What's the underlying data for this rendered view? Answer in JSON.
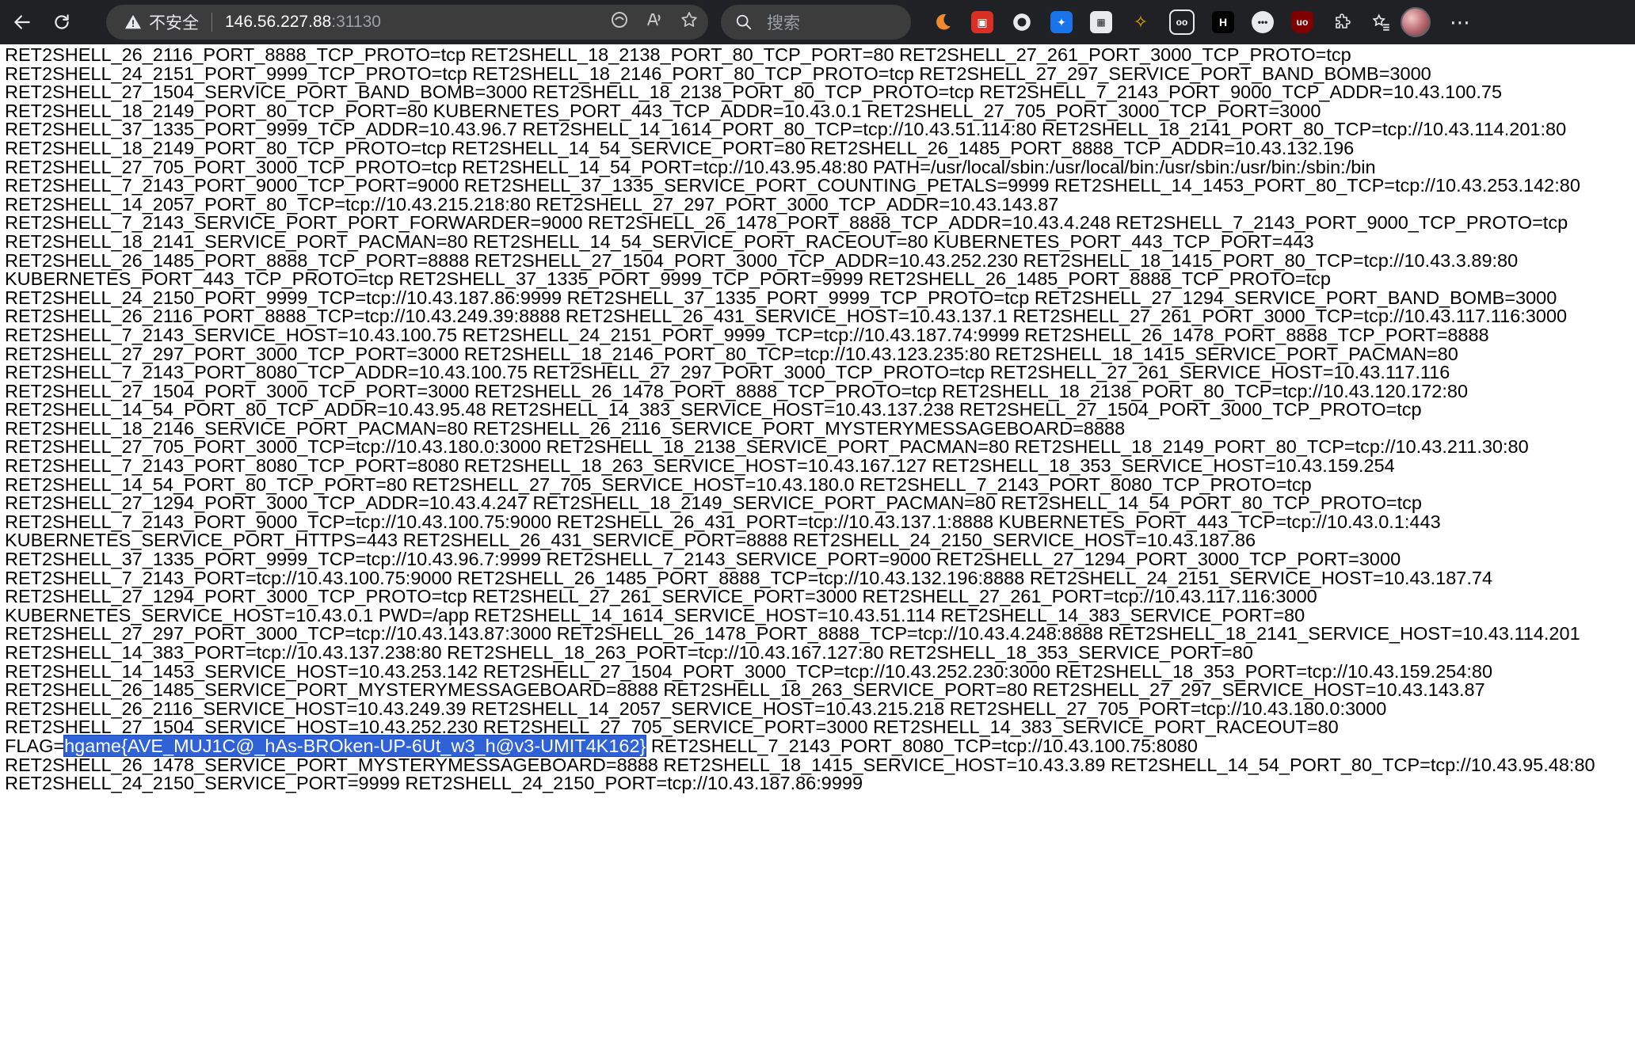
{
  "browser": {
    "security_label": "不安全",
    "url_host": "146.56.227.88",
    "url_port": ":31130",
    "search_placeholder": "搜索"
  },
  "content": {
    "lines": [
      "RET2SHELL_26_2116_PORT_8888_TCP_PROTO=tcp RET2SHELL_18_2138_PORT_80_TCP_PORT=80 RET2SHELL_27_261_PORT_3000_TCP_PROTO=tcp",
      "RET2SHELL_24_2151_PORT_9999_TCP_PROTO=tcp RET2SHELL_18_2146_PORT_80_TCP_PROTO=tcp RET2SHELL_27_297_SERVICE_PORT_BAND_BOMB=3000",
      "RET2SHELL_27_1504_SERVICE_PORT_BAND_BOMB=3000 RET2SHELL_18_2138_PORT_80_TCP_PROTO=tcp RET2SHELL_7_2143_PORT_9000_TCP_ADDR=10.43.100.75",
      "RET2SHELL_18_2149_PORT_80_TCP_PORT=80 KUBERNETES_PORT_443_TCP_ADDR=10.43.0.1 RET2SHELL_27_705_PORT_3000_TCP_PORT=3000",
      "RET2SHELL_37_1335_PORT_9999_TCP_ADDR=10.43.96.7 RET2SHELL_14_1614_PORT_80_TCP=tcp://10.43.51.114:80 RET2SHELL_18_2141_PORT_80_TCP=tcp://10.43.114.201:80",
      "RET2SHELL_18_2149_PORT_80_TCP_PROTO=tcp RET2SHELL_14_54_SERVICE_PORT=80 RET2SHELL_26_1485_PORT_8888_TCP_ADDR=10.43.132.196",
      "RET2SHELL_27_705_PORT_3000_TCP_PROTO=tcp RET2SHELL_14_54_PORT=tcp://10.43.95.48:80 PATH=/usr/local/sbin:/usr/local/bin:/usr/sbin:/usr/bin:/sbin:/bin",
      "RET2SHELL_7_2143_PORT_9000_TCP_PORT=9000 RET2SHELL_37_1335_SERVICE_PORT_COUNTING_PETALS=9999 RET2SHELL_14_1453_PORT_80_TCP=tcp://10.43.253.142:80",
      "RET2SHELL_14_2057_PORT_80_TCP=tcp://10.43.215.218:80 RET2SHELL_27_297_PORT_3000_TCP_ADDR=10.43.143.87",
      "RET2SHELL_7_2143_SERVICE_PORT_PORT_FORWARDER=9000 RET2SHELL_26_1478_PORT_8888_TCP_ADDR=10.43.4.248 RET2SHELL_7_2143_PORT_9000_TCP_PROTO=tcp",
      "RET2SHELL_18_2141_SERVICE_PORT_PACMAN=80 RET2SHELL_14_54_SERVICE_PORT_RACEOUT=80 KUBERNETES_PORT_443_TCP_PORT=443",
      "RET2SHELL_26_1485_PORT_8888_TCP_PORT=8888 RET2SHELL_27_1504_PORT_3000_TCP_ADDR=10.43.252.230 RET2SHELL_18_1415_PORT_80_TCP=tcp://10.43.3.89:80",
      "KUBERNETES_PORT_443_TCP_PROTO=tcp RET2SHELL_37_1335_PORT_9999_TCP_PORT=9999 RET2SHELL_26_1485_PORT_8888_TCP_PROTO=tcp",
      "RET2SHELL_24_2150_PORT_9999_TCP=tcp://10.43.187.86:9999 RET2SHELL_37_1335_PORT_9999_TCP_PROTO=tcp RET2SHELL_27_1294_SERVICE_PORT_BAND_BOMB=3000",
      "RET2SHELL_26_2116_PORT_8888_TCP=tcp://10.43.249.39:8888 RET2SHELL_26_431_SERVICE_HOST=10.43.137.1 RET2SHELL_27_261_PORT_3000_TCP=tcp://10.43.117.116:3000",
      "RET2SHELL_7_2143_SERVICE_HOST=10.43.100.75 RET2SHELL_24_2151_PORT_9999_TCP=tcp://10.43.187.74:9999 RET2SHELL_26_1478_PORT_8888_TCP_PORT=8888",
      "RET2SHELL_27_297_PORT_3000_TCP_PORT=3000 RET2SHELL_18_2146_PORT_80_TCP=tcp://10.43.123.235:80 RET2SHELL_18_1415_SERVICE_PORT_PACMAN=80",
      "RET2SHELL_7_2143_PORT_8080_TCP_ADDR=10.43.100.75 RET2SHELL_27_297_PORT_3000_TCP_PROTO=tcp RET2SHELL_27_261_SERVICE_HOST=10.43.117.116",
      "RET2SHELL_27_1504_PORT_3000_TCP_PORT=3000 RET2SHELL_26_1478_PORT_8888_TCP_PROTO=tcp RET2SHELL_18_2138_PORT_80_TCP=tcp://10.43.120.172:80",
      "RET2SHELL_14_54_PORT_80_TCP_ADDR=10.43.95.48 RET2SHELL_14_383_SERVICE_HOST=10.43.137.238 RET2SHELL_27_1504_PORT_3000_TCP_PROTO=tcp",
      "RET2SHELL_18_2146_SERVICE_PORT_PACMAN=80 RET2SHELL_26_2116_SERVICE_PORT_MYSTERYMESSAGEBOARD=8888",
      "RET2SHELL_27_705_PORT_3000_TCP=tcp://10.43.180.0:3000 RET2SHELL_18_2138_SERVICE_PORT_PACMAN=80 RET2SHELL_18_2149_PORT_80_TCP=tcp://10.43.211.30:80",
      "RET2SHELL_7_2143_PORT_8080_TCP_PORT=8080 RET2SHELL_18_263_SERVICE_HOST=10.43.167.127 RET2SHELL_18_353_SERVICE_HOST=10.43.159.254",
      "RET2SHELL_14_54_PORT_80_TCP_PORT=80 RET2SHELL_27_705_SERVICE_HOST=10.43.180.0 RET2SHELL_7_2143_PORT_8080_TCP_PROTO=tcp",
      "RET2SHELL_27_1294_PORT_3000_TCP_ADDR=10.43.4.247 RET2SHELL_18_2149_SERVICE_PORT_PACMAN=80 RET2SHELL_14_54_PORT_80_TCP_PROTO=tcp",
      "RET2SHELL_7_2143_PORT_9000_TCP=tcp://10.43.100.75:9000 RET2SHELL_26_431_PORT=tcp://10.43.137.1:8888 KUBERNETES_PORT_443_TCP=tcp://10.43.0.1:443",
      "KUBERNETES_SERVICE_PORT_HTTPS=443 RET2SHELL_26_431_SERVICE_PORT=8888 RET2SHELL_24_2150_SERVICE_HOST=10.43.187.86",
      "RET2SHELL_37_1335_PORT_9999_TCP=tcp://10.43.96.7:9999 RET2SHELL_7_2143_SERVICE_PORT=9000 RET2SHELL_27_1294_PORT_3000_TCP_PORT=3000",
      "RET2SHELL_7_2143_PORT=tcp://10.43.100.75:9000 RET2SHELL_26_1485_PORT_8888_TCP=tcp://10.43.132.196:8888 RET2SHELL_24_2151_SERVICE_HOST=10.43.187.74",
      "RET2SHELL_27_1294_PORT_3000_TCP_PROTO=tcp RET2SHELL_27_261_SERVICE_PORT=3000 RET2SHELL_27_261_PORT=tcp://10.43.117.116:3000",
      "KUBERNETES_SERVICE_HOST=10.43.0.1 PWD=/app RET2SHELL_14_1614_SERVICE_HOST=10.43.51.114 RET2SHELL_14_383_SERVICE_PORT=80",
      "RET2SHELL_27_297_PORT_3000_TCP=tcp://10.43.143.87:3000 RET2SHELL_26_1478_PORT_8888_TCP=tcp://10.43.4.248:8888 RET2SHELL_18_2141_SERVICE_HOST=10.43.114.201",
      "RET2SHELL_14_383_PORT=tcp://10.43.137.238:80 RET2SHELL_18_263_PORT=tcp://10.43.167.127:80 RET2SHELL_18_353_SERVICE_PORT=80",
      "RET2SHELL_14_1453_SERVICE_HOST=10.43.253.142 RET2SHELL_27_1504_PORT_3000_TCP=tcp://10.43.252.230:3000 RET2SHELL_18_353_PORT=tcp://10.43.159.254:80",
      "RET2SHELL_26_1485_SERVICE_PORT_MYSTERYMESSAGEBOARD=8888 RET2SHELL_18_263_SERVICE_PORT=80 RET2SHELL_27_297_SERVICE_HOST=10.43.143.87",
      "RET2SHELL_26_2116_SERVICE_HOST=10.43.249.39 RET2SHELL_14_2057_SERVICE_HOST=10.43.215.218 RET2SHELL_27_705_PORT=tcp://10.43.180.0:3000",
      "RET2SHELL_27_1504_SERVICE_HOST=10.43.252.230 RET2SHELL_27_705_SERVICE_PORT=3000 RET2SHELL_14_383_SERVICE_PORT_RACEOUT=80"
    ],
    "flag_line": {
      "prefix": "FLAG=",
      "highlighted": "hgame{AVE_MUJ1C@_hAs-BROken-UP-6Ut_w3_h@v3-UMIT4K162}",
      "suffix": " RET2SHELL_7_2143_PORT_8080_TCP=tcp://10.43.100.75:8080"
    },
    "after_lines": [
      "RET2SHELL_26_1478_SERVICE_PORT_MYSTERYMESSAGEBOARD=8888 RET2SHELL_18_1415_SERVICE_HOST=10.43.3.89 RET2SHELL_14_54_PORT_80_TCP=tcp://10.43.95.48:80",
      "RET2SHELL_24_2150_SERVICE_PORT=9999 RET2SHELL_24_2150_PORT=tcp://10.43.187.86:9999"
    ]
  }
}
